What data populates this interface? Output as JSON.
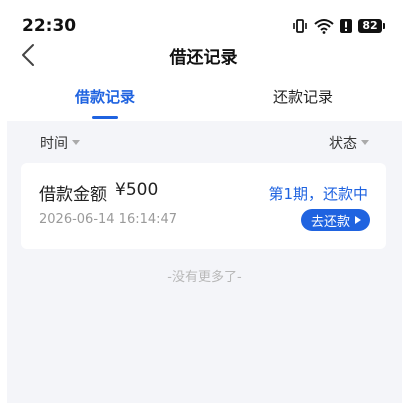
{
  "status_bar": {
    "time": "22:30",
    "battery": "82",
    "icons": [
      "vibrate-icon",
      "wifi-icon",
      "alert-icon",
      "battery-icon"
    ]
  },
  "header": {
    "title": "借还记录",
    "back_icon": "chevron-left-icon"
  },
  "tabs": [
    {
      "label": "借款记录",
      "active": true
    },
    {
      "label": "还款记录",
      "active": false
    }
  ],
  "filters": {
    "time_label": "时间",
    "status_label": "状态"
  },
  "records": [
    {
      "amount_label": "借款金额",
      "amount": "¥500",
      "date": "2026-06-14 16:14:47",
      "status": "第1期，还款中",
      "action_label": "去还款"
    }
  ],
  "footer": {
    "no_more": "-没有更多了-"
  },
  "colors": {
    "accent": "#1f63e0",
    "background": "#f4f5f9",
    "card": "#ffffff",
    "muted": "#9a9a9a"
  }
}
